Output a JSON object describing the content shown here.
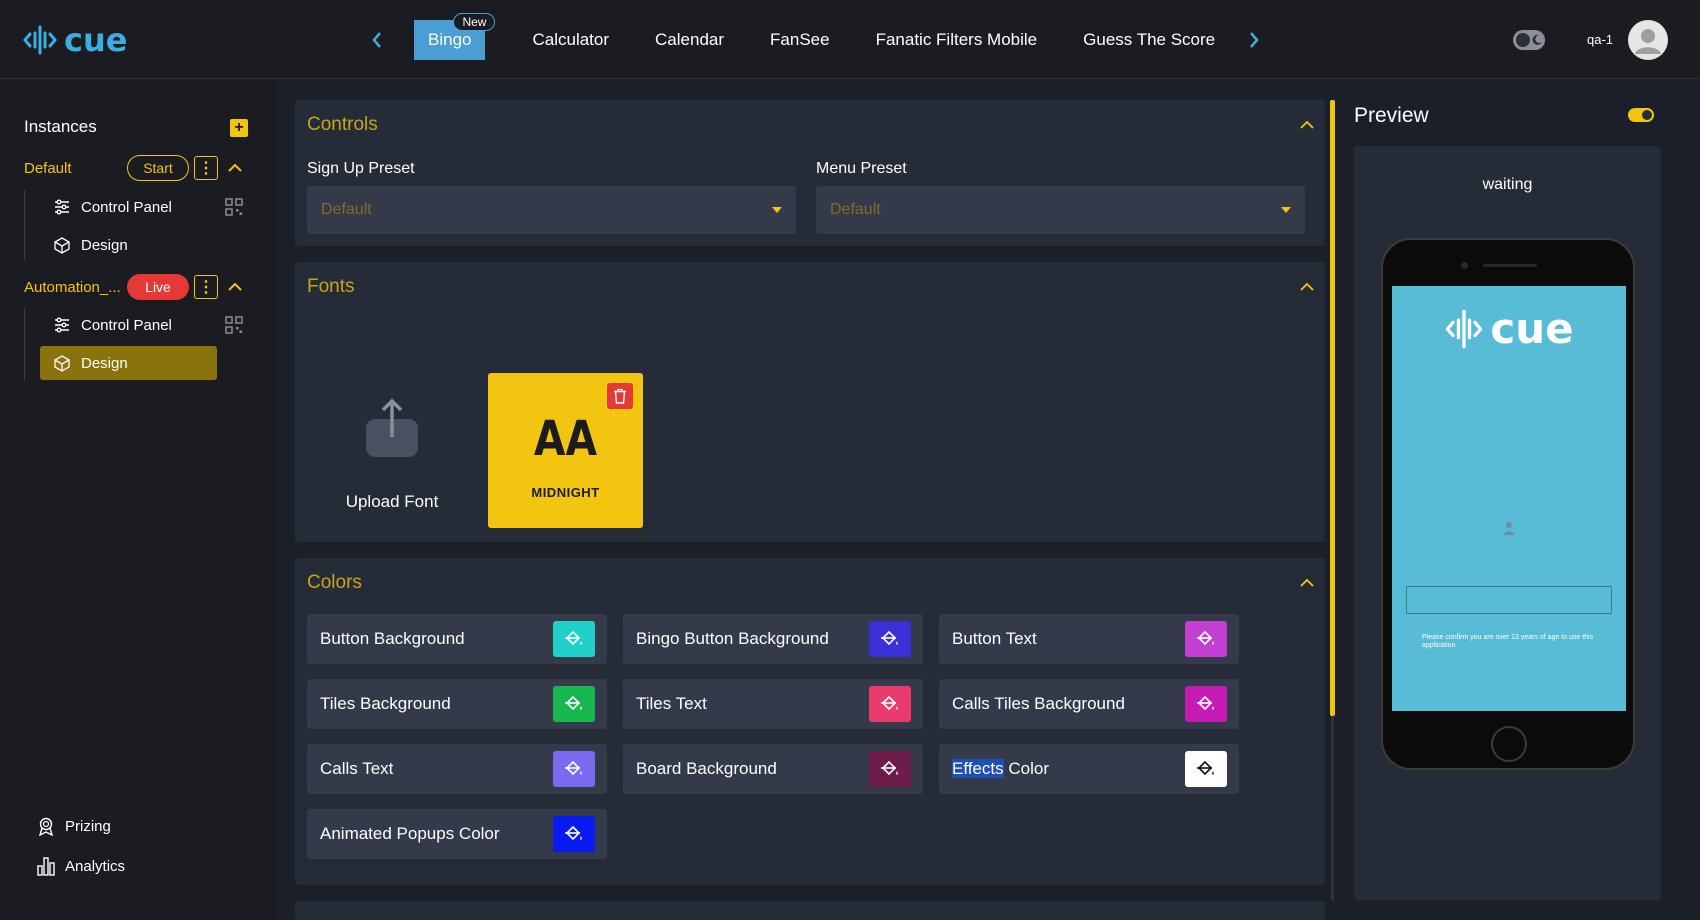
{
  "app": {
    "logo_text": "cue"
  },
  "header": {
    "tabs": [
      {
        "label": "Bingo",
        "badge": "New",
        "active": true
      },
      {
        "label": "Calculator"
      },
      {
        "label": "Calendar"
      },
      {
        "label": "FanSee"
      },
      {
        "label": "Fanatic Filters Mobile"
      },
      {
        "label": "Guess The Score"
      }
    ],
    "user": "qa-1",
    "icons": [
      "chevron-left-icon",
      "chevron-right-icon",
      "theme-toggle-icon",
      "avatar-icon"
    ]
  },
  "sidebar": {
    "title": "Instances",
    "instances": [
      {
        "name": "Default",
        "status": "Start",
        "items": [
          {
            "label": "Control Panel",
            "icon": "sliders-icon"
          },
          {
            "label": "Design",
            "icon": "cube-icon"
          }
        ]
      },
      {
        "name": "Automation_...",
        "status": "Live",
        "items": [
          {
            "label": "Control Panel",
            "icon": "sliders-icon"
          },
          {
            "label": "Design",
            "icon": "cube-icon",
            "active": true
          }
        ]
      }
    ],
    "bottom": [
      {
        "label": "Prizing",
        "icon": "award-icon"
      },
      {
        "label": "Analytics",
        "icon": "bar-chart-icon"
      }
    ]
  },
  "controls": {
    "title": "Controls",
    "sign_up_preset": {
      "label": "Sign Up Preset",
      "value": "Default"
    },
    "menu_preset": {
      "label": "Menu Preset",
      "value": "Default"
    }
  },
  "fonts": {
    "title": "Fonts",
    "upload_label": "Upload Font",
    "cards": [
      {
        "preview": "AA",
        "name": "MIDNIGHT"
      }
    ]
  },
  "colors": {
    "title": "Colors",
    "items": [
      {
        "label": "Button Background",
        "color": "#1fd1c9"
      },
      {
        "label": "Bingo Button Background",
        "color": "#3b2fd8"
      },
      {
        "label": "Button Text",
        "color": "#c13fd1"
      },
      {
        "label": "Tiles Background",
        "color": "#16b84e"
      },
      {
        "label": "Tiles Text",
        "color": "#ea3c6c"
      },
      {
        "label": "Calls Tiles Background",
        "color": "#c71bb6"
      },
      {
        "label": "Calls Text",
        "color": "#7b6af0"
      },
      {
        "label": "Board Background",
        "color": "#6e1d4a"
      },
      {
        "label_hl": "Effects",
        "label_rest": " Color",
        "color": "#ffffff"
      },
      {
        "label": "Animated Popups Color",
        "color": "#0a1bf0"
      }
    ]
  },
  "preview": {
    "title": "Preview",
    "status": "waiting",
    "screen_logo": "cue",
    "note": "Please confirm you are over 13 years of age to use this application",
    "screen_color": "#58bcd6"
  }
}
